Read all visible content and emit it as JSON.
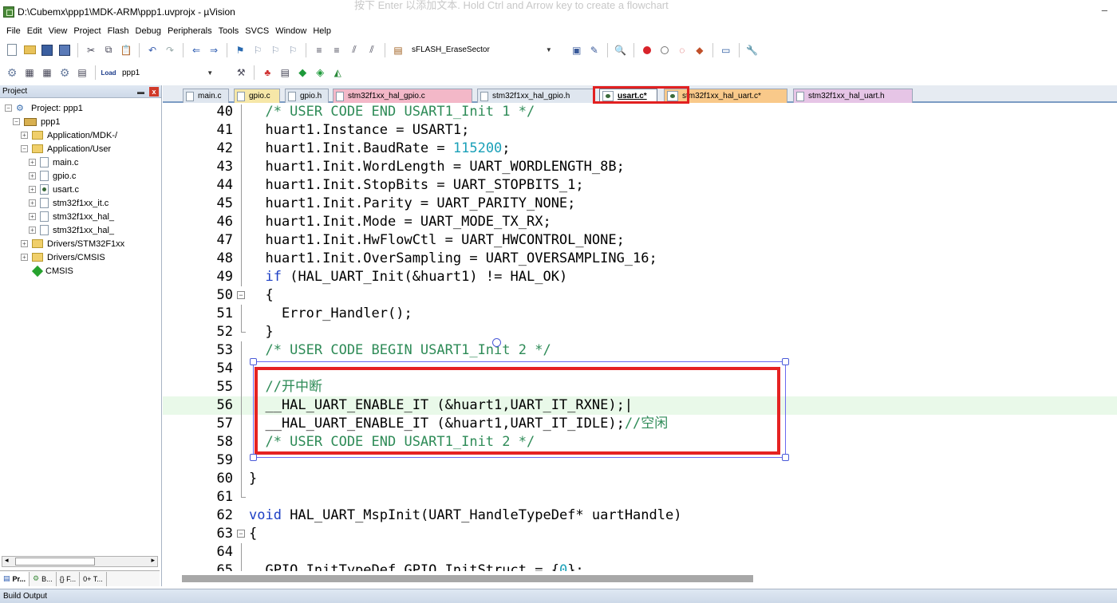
{
  "window": {
    "title": "D:\\Cubemx\\ppp1\\MDK-ARM\\ppp1.uvprojx - µVision",
    "hint": "按下 Enter 以添加文本. Hold Ctrl and Arrow key to create a flowchart",
    "minimize_glyph": "–"
  },
  "menu": [
    "File",
    "Edit",
    "View",
    "Project",
    "Flash",
    "Debug",
    "Peripherals",
    "Tools",
    "SVCS",
    "Window",
    "Help"
  ],
  "toolbar": {
    "flash_combo": "sFLASH_EraseSector",
    "target_combo": "ppp1",
    "load_label": "Load"
  },
  "project_panel": {
    "title": "Project",
    "pin": "\u0007",
    "close": "x",
    "tree": [
      {
        "label": "Project: ppp1",
        "icon": "project-icon",
        "indent": 0,
        "toggle": "−"
      },
      {
        "label": "ppp1",
        "icon": "target-icon",
        "indent": 1,
        "toggle": "−"
      },
      {
        "label": "Application/MDK-/",
        "icon": "folder-icon",
        "indent": 2,
        "toggle": "+"
      },
      {
        "label": "Application/User",
        "icon": "folder-icon",
        "indent": 2,
        "toggle": "−"
      },
      {
        "label": "main.c",
        "icon": "file-icon",
        "indent": 3,
        "toggle": "+"
      },
      {
        "label": "gpio.c",
        "icon": "file-icon",
        "indent": 3,
        "toggle": "+"
      },
      {
        "label": "usart.c",
        "icon": "source-file-icon",
        "indent": 3,
        "toggle": "+"
      },
      {
        "label": "stm32f1xx_it.c",
        "icon": "file-icon",
        "indent": 3,
        "toggle": "+"
      },
      {
        "label": "stm32f1xx_hal_",
        "icon": "file-icon",
        "indent": 3,
        "toggle": "+"
      },
      {
        "label": "stm32f1xx_hal_",
        "icon": "file-icon",
        "indent": 3,
        "toggle": "+"
      },
      {
        "label": "Drivers/STM32F1xx",
        "icon": "folder-icon",
        "indent": 2,
        "toggle": "+"
      },
      {
        "label": "Drivers/CMSIS",
        "icon": "folder-icon",
        "indent": 2,
        "toggle": "+"
      },
      {
        "label": "CMSIS",
        "icon": "component-icon",
        "indent": 2,
        "toggle": ""
      }
    ],
    "bottom_tabs": [
      "Pr...",
      "B...",
      "{} F...",
      "0+ T..."
    ],
    "scroll_left": "◂",
    "scroll_right": "▸"
  },
  "editor_tabs": [
    {
      "label": "main.c",
      "color": "#dfe6ef",
      "active": false,
      "special": false
    },
    {
      "label": "gpio.c",
      "color": "#f6e7a8",
      "active": false,
      "special": false
    },
    {
      "label": "gpio.h",
      "color": "#dfe6ef",
      "active": false,
      "special": false
    },
    {
      "label": "stm32f1xx_hal_gpio.c",
      "color": "#f3b8c8",
      "active": false,
      "special": false
    },
    {
      "label": "stm32f1xx_hal_gpio.h",
      "color": "#dfe6ef",
      "active": false,
      "special": false
    },
    {
      "label": "usart.c*",
      "color": "#ffffff",
      "active": true,
      "special": true
    },
    {
      "label": "stm32f1xx_hal_uart.c*",
      "color": "#f9c98a",
      "active": false,
      "special": true
    },
    {
      "label": "stm32f1xx_hal_uart.h",
      "color": "#e6c5e6",
      "active": false,
      "special": false
    }
  ],
  "code_lines": [
    {
      "n": "40",
      "fold": "vline",
      "parts": [
        {
          "t": "  /* USER CODE END USART1_Init 1 */",
          "c": "comment"
        }
      ]
    },
    {
      "n": "41",
      "fold": "vline",
      "parts": [
        {
          "t": "  huart1.Instance = USART1;",
          "c": ""
        }
      ]
    },
    {
      "n": "42",
      "fold": "vline",
      "parts": [
        {
          "t": "  huart1.Init.BaudRate = ",
          "c": ""
        },
        {
          "t": "115200",
          "c": "number"
        },
        {
          "t": ";",
          "c": ""
        }
      ]
    },
    {
      "n": "43",
      "fold": "vline",
      "parts": [
        {
          "t": "  huart1.Init.WordLength = UART_WORDLENGTH_8B;",
          "c": ""
        }
      ]
    },
    {
      "n": "44",
      "fold": "vline",
      "parts": [
        {
          "t": "  huart1.Init.StopBits = UART_STOPBITS_1;",
          "c": ""
        }
      ]
    },
    {
      "n": "45",
      "fold": "vline",
      "parts": [
        {
          "t": "  huart1.Init.Parity = UART_PARITY_NONE;",
          "c": ""
        }
      ]
    },
    {
      "n": "46",
      "fold": "vline",
      "parts": [
        {
          "t": "  huart1.Init.Mode = UART_MODE_TX_RX;",
          "c": ""
        }
      ]
    },
    {
      "n": "47",
      "fold": "vline",
      "parts": [
        {
          "t": "  huart1.Init.HwFlowCtl = UART_HWCONTROL_NONE;",
          "c": ""
        }
      ]
    },
    {
      "n": "48",
      "fold": "vline",
      "parts": [
        {
          "t": "  huart1.Init.OverSampling = UART_OVERSAMPLING_16;",
          "c": ""
        }
      ]
    },
    {
      "n": "49",
      "fold": "vline",
      "parts": [
        {
          "t": "  ",
          "c": ""
        },
        {
          "t": "if",
          "c": "keyword"
        },
        {
          "t": " (HAL_UART_Init(&huart1) != HAL_OK)",
          "c": ""
        }
      ]
    },
    {
      "n": "50",
      "fold": "box",
      "parts": [
        {
          "t": "  {",
          "c": ""
        }
      ]
    },
    {
      "n": "51",
      "fold": "vline",
      "parts": [
        {
          "t": "    Error_Handler();",
          "c": ""
        }
      ]
    },
    {
      "n": "52",
      "fold": "end",
      "parts": [
        {
          "t": "  }",
          "c": ""
        }
      ]
    },
    {
      "n": "53",
      "fold": "vline",
      "parts": [
        {
          "t": "  /* USER CODE BEGIN USART1_Init 2 */",
          "c": "comment"
        }
      ]
    },
    {
      "n": "54",
      "fold": "vline",
      "parts": [
        {
          "t": "",
          "c": ""
        }
      ]
    },
    {
      "n": "55",
      "fold": "vline",
      "parts": [
        {
          "t": "  //开中断",
          "c": "comment"
        }
      ]
    },
    {
      "n": "56",
      "fold": "vline",
      "hl": true,
      "parts": [
        {
          "t": "  __HAL_UART_ENABLE_IT (&huart1,UART_IT_RXNE);|",
          "c": ""
        }
      ]
    },
    {
      "n": "57",
      "fold": "vline",
      "parts": [
        {
          "t": "  __HAL_UART_ENABLE_IT (&huart1,UART_IT_IDLE);",
          "c": ""
        },
        {
          "t": "//空闲",
          "c": "comment"
        }
      ]
    },
    {
      "n": "58",
      "fold": "vline",
      "parts": [
        {
          "t": "  /* USER CODE END USART1_Init 2 */",
          "c": "comment"
        }
      ]
    },
    {
      "n": "59",
      "fold": "vline",
      "parts": [
        {
          "t": "",
          "c": ""
        }
      ]
    },
    {
      "n": "60",
      "fold": "vline",
      "parts": [
        {
          "t": "}",
          "c": ""
        }
      ]
    },
    {
      "n": "61",
      "fold": "end",
      "parts": [
        {
          "t": "",
          "c": ""
        }
      ]
    },
    {
      "n": "62",
      "fold": "",
      "parts": [
        {
          "t": "void",
          "c": "keyword"
        },
        {
          "t": " HAL_UART_MspInit(UART_HandleTypeDef* uartHandle)",
          "c": ""
        }
      ]
    },
    {
      "n": "63",
      "fold": "box",
      "parts": [
        {
          "t": "{",
          "c": ""
        }
      ]
    },
    {
      "n": "64",
      "fold": "vline",
      "parts": [
        {
          "t": "",
          "c": ""
        }
      ]
    },
    {
      "n": "65",
      "fold": "vline",
      "parts": [
        {
          "t": "  GPIO_InitTypeDef GPIO_InitStruct = {",
          "c": ""
        },
        {
          "t": "0",
          "c": "number"
        },
        {
          "t": "};",
          "c": ""
        }
      ]
    }
  ],
  "build_output": {
    "label": "Build Output"
  },
  "colors": {
    "highlight_red": "#e52222",
    "comment": "#2e8b57",
    "keyword": "#1d3fc4",
    "number": "#1aa0b8",
    "current_line": "#e9f9e9"
  }
}
